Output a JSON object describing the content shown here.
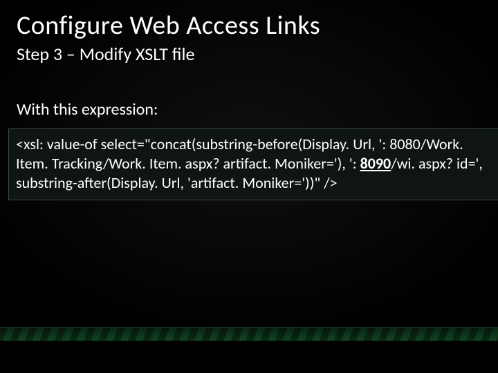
{
  "title": "Configure Web Access Links",
  "subtitle": "Step 3 – Modify XSLT file",
  "lead": "With this expression:",
  "code": {
    "pre": "<xsl: value-of select=\"concat(substring-before(Display. Url, ': 8080/Work. Item. Tracking/Work. Item. aspx? artifact. Moniker='), ': ",
    "emph": "8090",
    "post": "/wi. aspx? id=', substring-after(Display. Url, 'artifact. Moniker='))\" />"
  }
}
